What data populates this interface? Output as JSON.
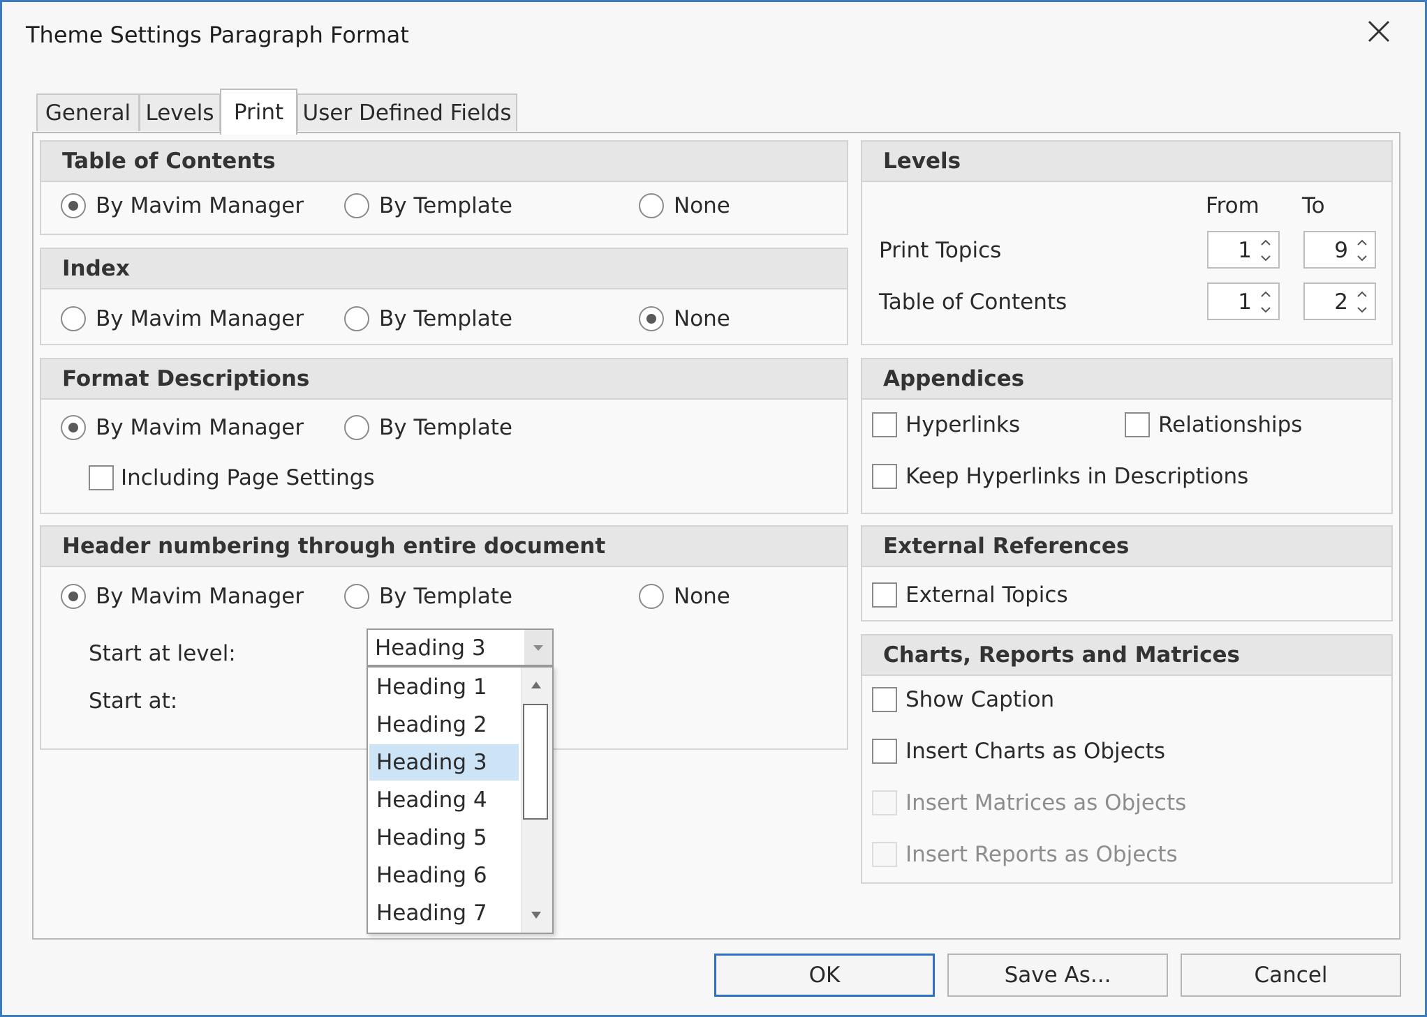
{
  "window": {
    "title": "Theme Settings Paragraph Format",
    "close_icon": "close-icon"
  },
  "tabs": [
    {
      "label": "General",
      "active": false
    },
    {
      "label": "Levels",
      "active": false
    },
    {
      "label": "Print",
      "active": true
    },
    {
      "label": "User Defined Fields",
      "active": false
    }
  ],
  "table_of_contents": {
    "title": "Table of Contents",
    "options": [
      "By Mavim Manager",
      "By Template",
      "None"
    ],
    "selected": "By Mavim Manager"
  },
  "index": {
    "title": "Index",
    "options": [
      "By Mavim Manager",
      "By Template",
      "None"
    ],
    "selected": "None"
  },
  "format_descriptions": {
    "title": "Format Descriptions",
    "options": [
      "By Mavim Manager",
      "By Template"
    ],
    "selected": "By Mavim Manager",
    "including_page_settings": {
      "label": "Including Page Settings",
      "checked": false
    }
  },
  "header_numbering": {
    "title": "Header numbering through entire document",
    "options": [
      "By Mavim Manager",
      "By Template",
      "None"
    ],
    "selected": "By Mavim Manager",
    "start_at_level_label": "Start at level:",
    "start_at_label": "Start at:",
    "start_at_level_value": "Heading 3",
    "dropdown_items": [
      "Heading 1",
      "Heading 2",
      "Heading 3",
      "Heading 4",
      "Heading 5",
      "Heading 6",
      "Heading 7"
    ],
    "dropdown_selected": "Heading 3"
  },
  "levels": {
    "title": "Levels",
    "from_label": "From",
    "to_label": "To",
    "rows": [
      {
        "label": "Print Topics",
        "from": "1",
        "to": "9"
      },
      {
        "label": "Table of Contents",
        "from": "1",
        "to": "2"
      }
    ]
  },
  "appendices": {
    "title": "Appendices",
    "hyperlinks": {
      "label": "Hyperlinks",
      "checked": false
    },
    "relationships": {
      "label": "Relationships",
      "checked": false
    },
    "keep_hyperlinks": {
      "label": "Keep Hyperlinks in Descriptions",
      "checked": false
    }
  },
  "external_references": {
    "title": "External References",
    "external_topics": {
      "label": "External Topics",
      "checked": false
    }
  },
  "charts": {
    "title": "Charts, Reports and Matrices",
    "show_caption": {
      "label": "Show Caption",
      "checked": false,
      "enabled": true
    },
    "insert_charts": {
      "label": "Insert Charts as Objects",
      "checked": false,
      "enabled": true
    },
    "insert_matrices": {
      "label": "Insert Matrices as Objects",
      "checked": false,
      "enabled": false
    },
    "insert_reports": {
      "label": "Insert Reports as Objects",
      "checked": false,
      "enabled": false
    }
  },
  "buttons": {
    "ok": "OK",
    "save_as": "Save As...",
    "cancel": "Cancel"
  },
  "colors": {
    "accent": "#2f6fc4",
    "selection": "#cde4f7",
    "group_header": "#e6e6e6"
  }
}
